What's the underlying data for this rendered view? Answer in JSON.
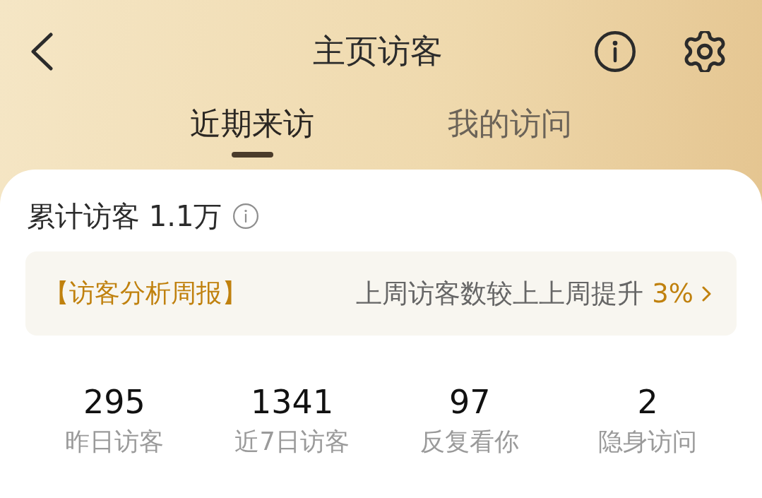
{
  "header": {
    "title": "主页访客"
  },
  "tabs": [
    {
      "label": "近期来访",
      "selected": true
    },
    {
      "label": "我的访问",
      "selected": false
    }
  ],
  "total": {
    "text": "累计访客 1.1万"
  },
  "weekly_report": {
    "title": "【访客分析周报】",
    "summary": "上周访客数较上上周提升",
    "change": "3%"
  },
  "stats": [
    {
      "value": "295",
      "label": "昨日访客"
    },
    {
      "value": "1341",
      "label": "近7日访客"
    },
    {
      "value": "97",
      "label": "反复看你"
    },
    {
      "value": "2",
      "label": "隐身访问"
    }
  ]
}
